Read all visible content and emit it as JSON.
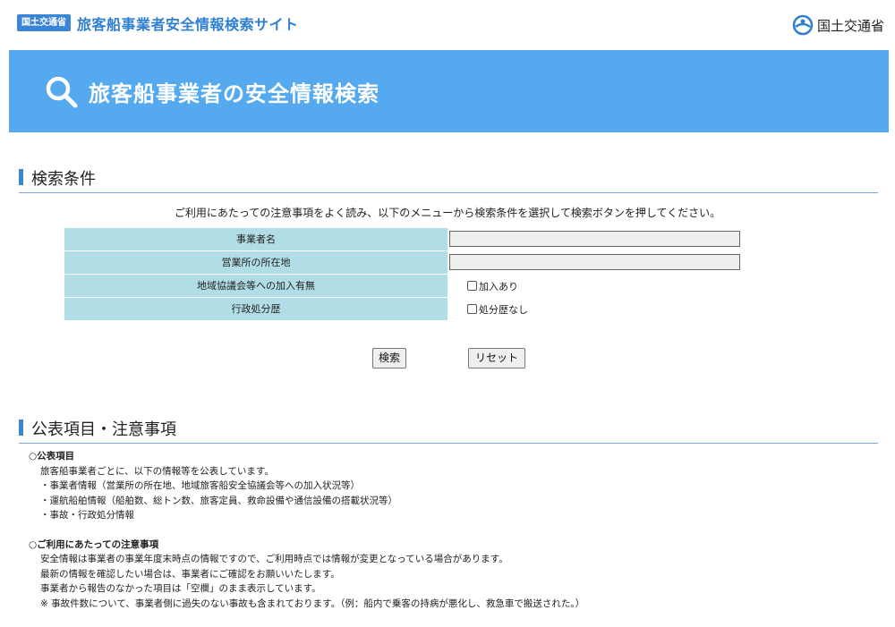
{
  "header": {
    "ministry_badge": "国土交通省",
    "site_title": "旅客船事業者安全情報検索サイト",
    "logo_text": "国土交通省"
  },
  "hero": {
    "title": "旅客船事業者の安全情報検索"
  },
  "search": {
    "section_title": "検索条件",
    "intro": "ご利用にあたっての注意事項をよく読み、以下のメニューから検索条件を選択して検索ボタンを押してください。",
    "fields": {
      "operator_name": {
        "label": "事業者名",
        "value": ""
      },
      "office_location": {
        "label": "営業所の所在地",
        "value": ""
      },
      "council": {
        "label": "地域協議会等への加入有無",
        "checkbox_label": "加入あり",
        "checked": false
      },
      "admin_action": {
        "label": "行政処分歴",
        "checkbox_label": "処分歴なし",
        "checked": false
      }
    },
    "search_button": "検索",
    "reset_button": "リセット"
  },
  "notice": {
    "section_title": "公表項目・注意事項",
    "public_items_heading": "○公表項目",
    "public_items": [
      "旅客船事業者ごとに、以下の情報等を公表しています。",
      "・事業者情報（営業所の所在地、地域旅客船安全協議会等への加入状況等）",
      "・運航船舶情報（船舶数、総トン数、旅客定員、救命設備や通信設備の搭載状況等）",
      "・事故・行政処分情報"
    ],
    "cautions_heading": "○ご利用にあたっての注意事項",
    "cautions": [
      "安全情報は事業者の事業年度末時点の情報ですので、ご利用時点では情報が変更となっている場合があります。",
      "最新の情報を確認したい場合は、事業者にご確認をお願いいたします。",
      "事業者から報告のなかった項目は「空欄」のまま表示しています。",
      "※ 事故件数について、事業者側に過失のない事故も含まれております。（例：船内で乗客の持病が悪化し、救急車で搬送された。）"
    ]
  },
  "colors": {
    "accent": "#3a86d6",
    "hero": "#55a9ee",
    "table_header": "#b1dde6"
  }
}
